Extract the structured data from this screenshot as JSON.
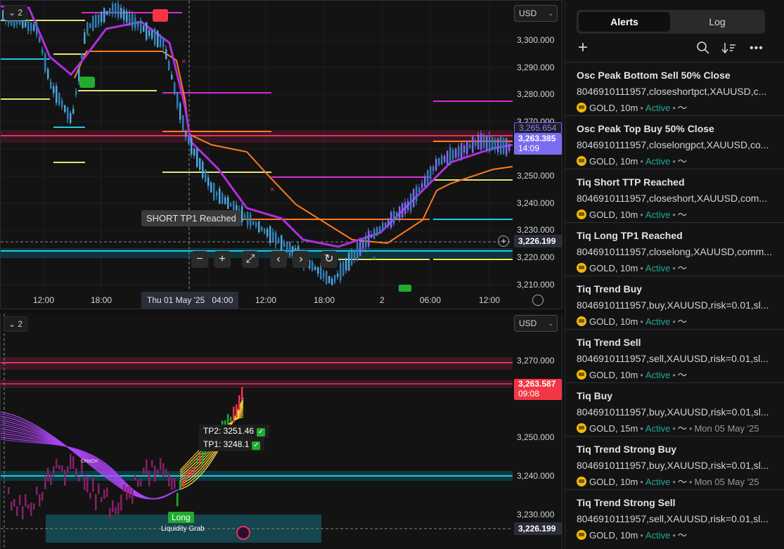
{
  "top_chart": {
    "pane_badge": "2",
    "currency": "USD",
    "price_ticks": [
      "3,300.000",
      "3,290.000",
      "3,280.000",
      "3,270.000",
      "3,250.000",
      "3,240.000",
      "3,230.000",
      "3,220.000",
      "3,210.000"
    ],
    "tag_high": "3,265.654",
    "tag_price": "3,263.385",
    "tag_countdown": "14:09",
    "tag_cross": "3,226.199",
    "time_labels": [
      "12:00",
      "18:00",
      "12:00",
      "18:00",
      "2",
      "06:00",
      "12:00"
    ],
    "date_pill": "Thu 01 May '25",
    "date_pill_time": "04:00",
    "tooltip": "SHORT TP1 Reached",
    "nav_buttons": [
      "−",
      "+",
      "⤢",
      "‹",
      "›",
      "↻"
    ],
    "colors": {
      "purple": "#b02ee0",
      "orange": "#ff7a1f",
      "cyan": "#21c8e0",
      "magenta": "#d829d8",
      "yellow": "#e0e66e",
      "red": "#e0365a"
    }
  },
  "bottom_chart": {
    "pane_badge": "2",
    "currency": "USD",
    "price_ticks": [
      "3,270.000",
      "3,250.000",
      "3,240.000",
      "3,230.000"
    ],
    "tag_price": "3,263.587",
    "tag_countdown": "09:08",
    "tag_cross": "3,226.199",
    "tp2_label": "TP2: 3251.46",
    "tp1_label": "TP1: 3248.1",
    "long_label": "Long",
    "liquidity_label": "Liquidity Grab",
    "choch_label": "CHoCH"
  },
  "panel": {
    "tabs": {
      "alerts": "Alerts",
      "log": "Log"
    },
    "toolbar_icons": [
      "plus-icon",
      "search-icon",
      "sort-icon",
      "more-icon"
    ],
    "alerts": [
      {
        "title": "Osc Peak Bottom Sell 50% Close",
        "message": "8046910111957,closeshortpct,XAUUSD,c...",
        "symbol": "GOLD, 10m",
        "status": "Active",
        "date": ""
      },
      {
        "title": "Osc Peak Top Buy 50% Close",
        "message": "8046910111957,closelongpct,XAUUSD,co...",
        "symbol": "GOLD, 10m",
        "status": "Active",
        "date": ""
      },
      {
        "title": "Tiq Short TTP Reached",
        "message": "8046910111957,closeshort,XAUUSD,com...",
        "symbol": "GOLD, 10m",
        "status": "Active",
        "date": ""
      },
      {
        "title": "Tiq Long TP1 Reached",
        "message": "8046910111957,closelong,XAUUSD,comm...",
        "symbol": "GOLD, 10m",
        "status": "Active",
        "date": ""
      },
      {
        "title": "Tiq Trend Buy",
        "message": "8046910111957,buy,XAUUSD,risk=0.01,sl...",
        "symbol": "GOLD, 10m",
        "status": "Active",
        "date": ""
      },
      {
        "title": "Tiq Trend Sell",
        "message": "8046910111957,sell,XAUUSD,risk=0.01,sl...",
        "symbol": "GOLD, 10m",
        "status": "Active",
        "date": ""
      },
      {
        "title": "Tiq Buy",
        "message": "8046910111957,buy,XAUUSD,risk=0.01,sl...",
        "symbol": "GOLD, 15m",
        "status": "Active",
        "date": "Mon 05 May '25"
      },
      {
        "title": "Tiq Trend Strong Buy",
        "message": "8046910111957,buy,XAUUSD,risk=0.01,sl...",
        "symbol": "GOLD, 10m",
        "status": "Active",
        "date": "Mon 05 May '25"
      },
      {
        "title": "Tiq Trend Strong Sell",
        "message": "8046910111957,sell,XAUUSD,risk=0.01,sl...",
        "symbol": "GOLD, 10m",
        "status": "Active",
        "date": ""
      }
    ]
  }
}
